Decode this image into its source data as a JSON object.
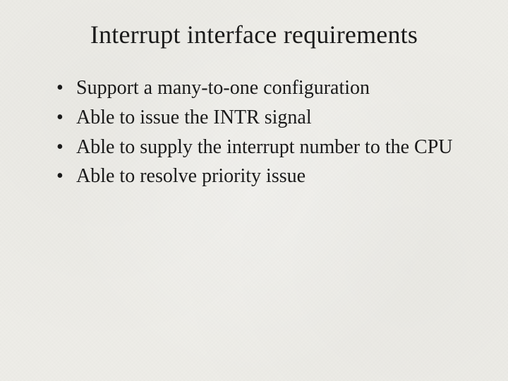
{
  "slide": {
    "title": "Interrupt interface requirements",
    "bullets": [
      "Support a many-to-one configuration",
      "Able to issue the INTR signal",
      "Able to supply the interrupt number to the CPU",
      "Able to resolve priority issue"
    ]
  }
}
